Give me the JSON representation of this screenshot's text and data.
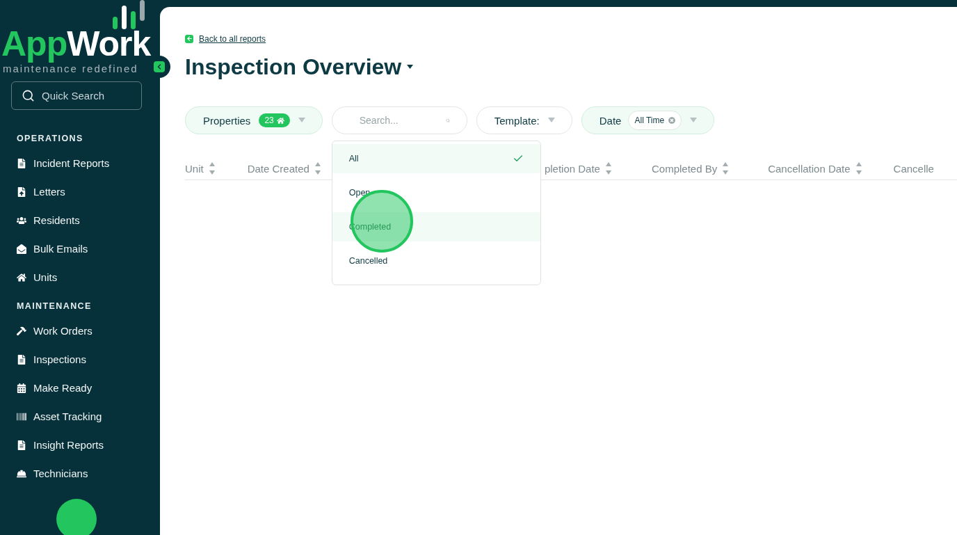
{
  "logo": {
    "brand_first": "App",
    "brand_second": "Work",
    "tagline": "maintenance redefined"
  },
  "sidebar": {
    "search": {
      "placeholder": "Quick Search"
    },
    "sections": [
      {
        "title": "OPERATIONS",
        "items": [
          {
            "label": "Incident Reports",
            "kind": "document"
          },
          {
            "label": "Letters",
            "kind": "upload"
          },
          {
            "label": "Residents",
            "kind": "people"
          },
          {
            "label": "Bulk Emails",
            "kind": "mail"
          },
          {
            "label": "Units",
            "kind": "home"
          }
        ]
      },
      {
        "title": "MAINTENANCE",
        "items": [
          {
            "label": "Work Orders",
            "kind": "tools"
          },
          {
            "label": "Inspections",
            "kind": "document"
          },
          {
            "label": "Make Ready",
            "kind": "calendar"
          },
          {
            "label": "Asset Tracking",
            "kind": "barcode"
          },
          {
            "label": "Insight Reports",
            "kind": "document"
          },
          {
            "label": "Technicians",
            "kind": "helmet"
          }
        ]
      }
    ]
  },
  "main": {
    "back_link": "Back to all reports",
    "title": "Inspection Overview",
    "filters": [
      {
        "kind": "properties",
        "label": "Properties",
        "count": "23",
        "active": true
      },
      {
        "kind": "search",
        "placeholder": "Search...",
        "active": false
      },
      {
        "kind": "select",
        "label": "Template:",
        "active": false
      },
      {
        "kind": "date",
        "label": "Date",
        "value": "All Time",
        "active": true
      }
    ],
    "dropdown": {
      "options": [
        {
          "label": "All",
          "selected": true,
          "highlighted": false
        },
        {
          "label": "Open",
          "selected": false,
          "highlighted": false
        },
        {
          "label": "Completed",
          "selected": false,
          "highlighted": true
        },
        {
          "label": "Cancelled",
          "selected": false,
          "highlighted": false
        }
      ]
    },
    "table": {
      "columns": [
        {
          "label": "Unit",
          "sortable": true
        },
        {
          "label": "Date Created",
          "sortable": true
        },
        {
          "label": "pletion Date",
          "sortable": true
        },
        {
          "label": "Completed By",
          "sortable": true
        },
        {
          "label": "Cancellation Date",
          "sortable": true
        },
        {
          "label": "Cancelle",
          "sortable": false
        }
      ]
    }
  }
}
